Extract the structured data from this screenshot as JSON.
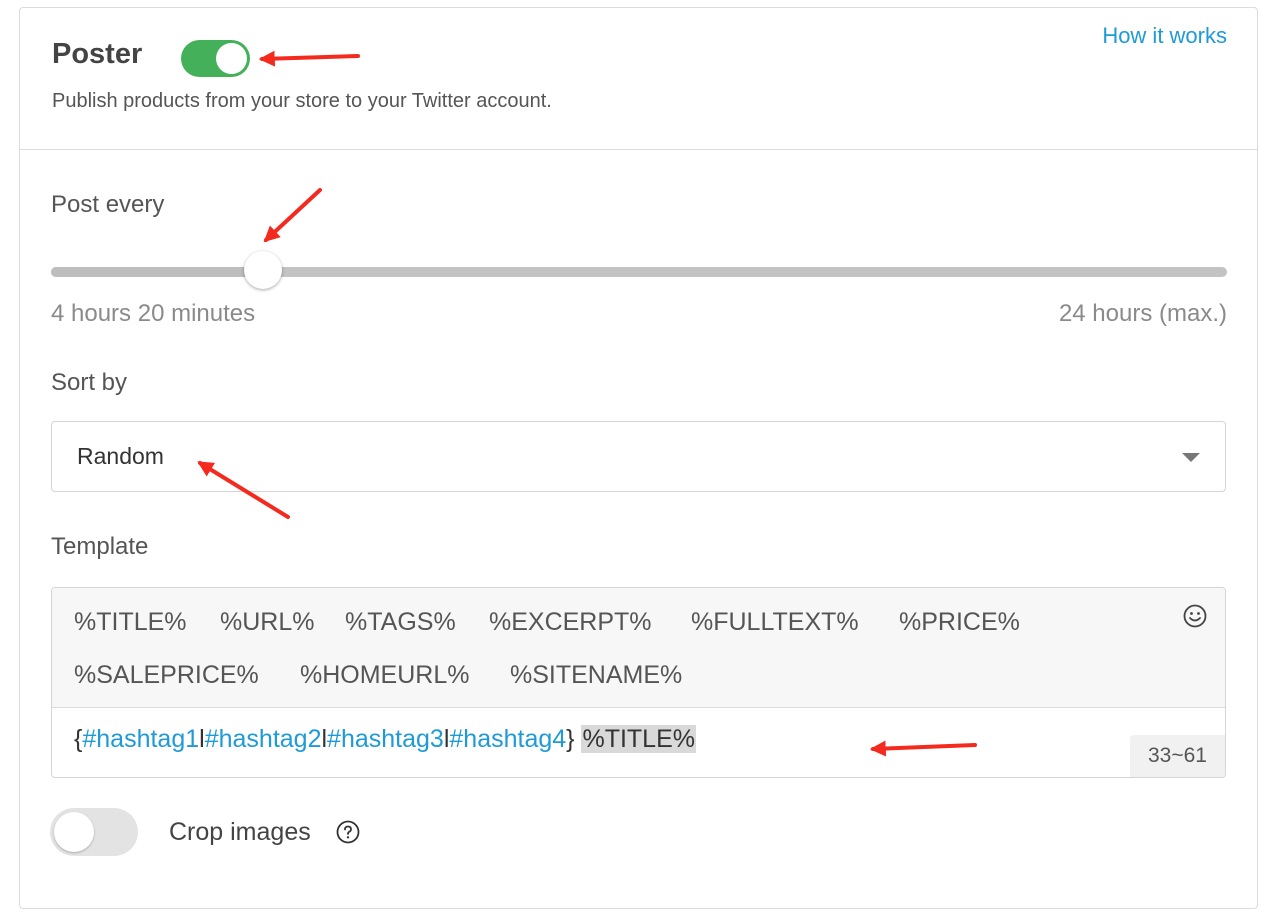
{
  "header": {
    "title": "Poster",
    "description": "Publish products from your store to your Twitter account.",
    "how_it_works": "How it works",
    "poster_enabled": true
  },
  "post_every": {
    "label": "Post every",
    "min_label": "4 hours 20 minutes",
    "max_label": "24 hours (max.)",
    "slider_fraction": 0.18
  },
  "sort_by": {
    "label": "Sort by",
    "selected": "Random"
  },
  "template": {
    "label": "Template",
    "variables": [
      "%TITLE%",
      "%URL%",
      "%TAGS%",
      "%EXCERPT%",
      "%FULLTEXT%",
      "%PRICE%",
      "%SALEPRICE%",
      "%HOMEURL%",
      "%SITENAME%"
    ],
    "text_open": "{",
    "hashtags": [
      "#hashtag1",
      "#hashtag2",
      "#hashtag3",
      "#hashtag4"
    ],
    "separator": "l",
    "text_close": "} ",
    "highlight": "%TITLE%",
    "counter": "33~61",
    "emoji_icon": "smiley-icon"
  },
  "crop_images": {
    "label": "Crop images",
    "enabled": false,
    "help_icon": "question-circle-icon"
  },
  "colors": {
    "accent": "#1e9bd6",
    "toggle_on": "#44b15a",
    "annotation_arrow": "#f42a1f"
  }
}
